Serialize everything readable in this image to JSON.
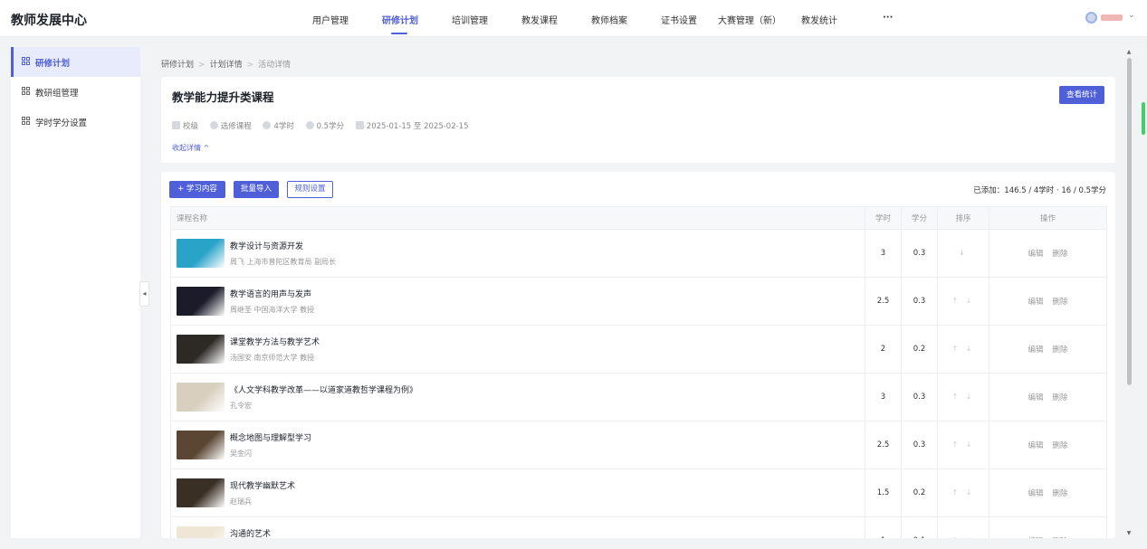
{
  "app": {
    "title": "教师发展中心"
  },
  "nav": {
    "items": [
      "用户管理",
      "研修计划",
      "培训管理",
      "教发课程",
      "教师档案",
      "证书设置",
      "大赛管理（新）",
      "教发统计",
      "···"
    ],
    "active_index": 1
  },
  "user": {
    "chevron": "⌄"
  },
  "sidebar": {
    "items": [
      {
        "label": "研修计划",
        "active": true
      },
      {
        "label": "教研组管理",
        "active": false
      },
      {
        "label": "学时学分设置",
        "active": false
      }
    ],
    "collapse_glyph": "◂"
  },
  "breadcrumb": [
    "研修计划",
    "计划详情",
    "活动详情"
  ],
  "header": {
    "title": "教学能力提升类课程",
    "stats_button": "查看统计",
    "meta": [
      "校级",
      "选修课程",
      "4学时",
      "0.5学分",
      "2025-01-15 至 2025-02-15"
    ],
    "collapse_link": "收起详情 ^"
  },
  "toolbar": {
    "add_content": "+ 学习内容",
    "batch_import": "批量导入",
    "rule_settings": "规则设置",
    "summary": "已添加：146.5 / 4学时 · 16 / 0.5学分"
  },
  "table": {
    "headers": [
      "课程名称",
      "学时",
      "学分",
      "排序",
      "操作"
    ],
    "edit_label": "编辑",
    "delete_label": "删除",
    "rows": [
      {
        "title": "教学设计与资源开发",
        "subtitle": "周飞 上海市普陀区教育局 副局长",
        "hours": "3",
        "credits": "0.3",
        "sort": "↓",
        "thumb_color": "#2aa3c9"
      },
      {
        "title": "教学语言的用声与发声",
        "subtitle": "周继圣 中国海洋大学 教授",
        "hours": "2.5",
        "credits": "0.3",
        "sort": "↑ ↓",
        "thumb_color": "#1b1b2a"
      },
      {
        "title": "课堂教学方法与教学艺术",
        "subtitle": "汤国安 南京师范大学 教授",
        "hours": "2",
        "credits": "0.2",
        "sort": "↑ ↓",
        "thumb_color": "#2d2a26"
      },
      {
        "title": "《人文学科教学改革——以道家道教哲学课程为例》",
        "subtitle": "孔令宏",
        "hours": "3",
        "credits": "0.3",
        "sort": "↑ ↓",
        "thumb_color": "#d9cfbf"
      },
      {
        "title": "概念地图与理解型学习",
        "subtitle": "吴金闪",
        "hours": "2.5",
        "credits": "0.3",
        "sort": "↑ ↓",
        "thumb_color": "#5b4634"
      },
      {
        "title": "现代教学幽默艺术",
        "subtitle": "赵瑞兵",
        "hours": "1.5",
        "credits": "0.2",
        "sort": "↑ ↓",
        "thumb_color": "#3a2f25"
      },
      {
        "title": "沟通的艺术",
        "subtitle": "",
        "hours": "1",
        "credits": "0.1",
        "sort": "↑ ↓",
        "thumb_color": "#efe6d6"
      }
    ]
  }
}
